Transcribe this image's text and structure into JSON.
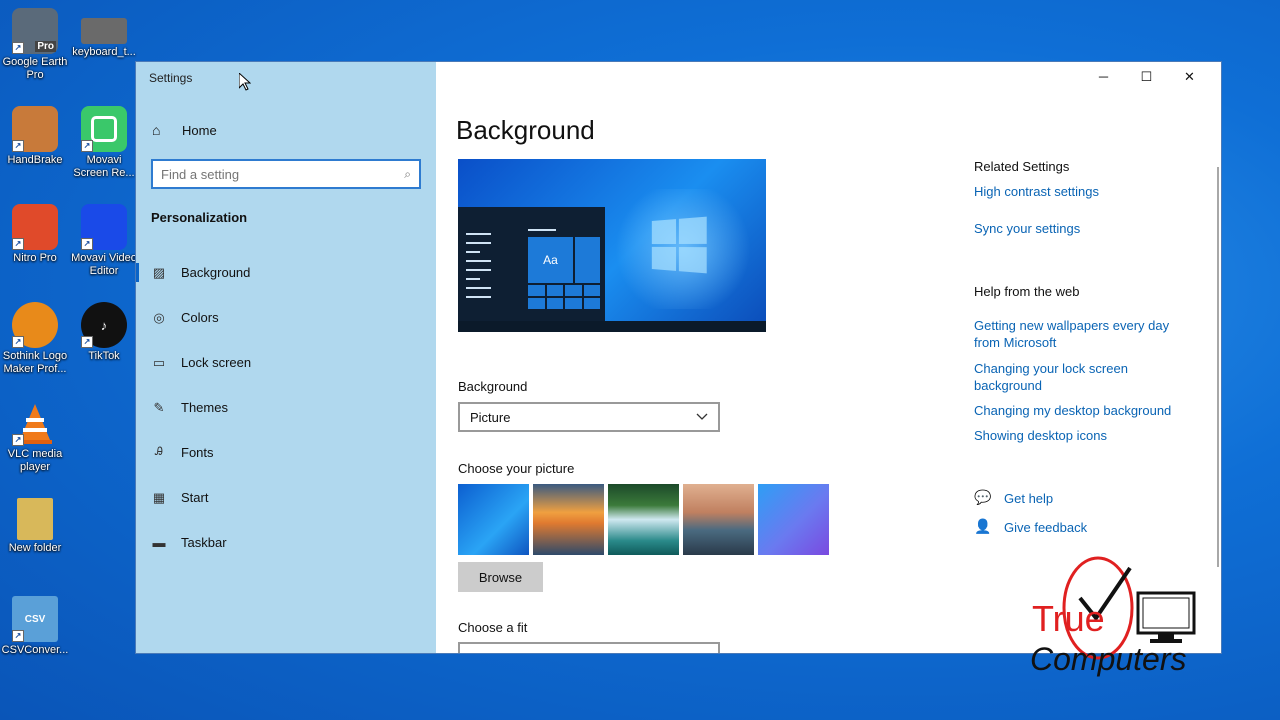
{
  "desktop": {
    "icons": [
      {
        "label": "Google Earth Pro",
        "badge": "Pro",
        "color": "#5a6a7a"
      },
      {
        "label": "keyboard_t...",
        "badge": "",
        "color": "#6a6a6a"
      },
      {
        "label": "HandBrake",
        "badge": "",
        "color": "#c87a3a"
      },
      {
        "label": "Movavi Screen Re...",
        "badge": "",
        "color": "#3ac86a"
      },
      {
        "label": "Nitro Pro",
        "badge": "",
        "color": "#e04a2a"
      },
      {
        "label": "Movavi Video Editor",
        "badge": "",
        "color": "#1a4ae8"
      },
      {
        "label": "Sothink Logo Maker Prof...",
        "badge": "",
        "color": "#e88a1a"
      },
      {
        "label": "TikTok",
        "badge": "",
        "color": "#111111"
      },
      {
        "label": "VLC media player",
        "badge": "",
        "color": "#f07a1a"
      },
      {
        "label": "New folder",
        "badge": "",
        "color": "#d8b85a"
      },
      {
        "label": "CSVConver...",
        "badge": "CSV",
        "color": "#5aa0d8"
      }
    ]
  },
  "window": {
    "title": "Settings",
    "controls": {
      "minimize": "─",
      "maximize": "☐",
      "close": "✕"
    }
  },
  "sidebar": {
    "home": "Home",
    "search_placeholder": "Find a setting",
    "section": "Personalization",
    "items": [
      {
        "label": "Background",
        "icon": "image-icon",
        "active": true
      },
      {
        "label": "Colors",
        "icon": "palette-icon",
        "active": false
      },
      {
        "label": "Lock screen",
        "icon": "lock-screen-icon",
        "active": false
      },
      {
        "label": "Themes",
        "icon": "brush-icon",
        "active": false
      },
      {
        "label": "Fonts",
        "icon": "font-icon",
        "active": false
      },
      {
        "label": "Start",
        "icon": "start-icon",
        "active": false
      },
      {
        "label": "Taskbar",
        "icon": "taskbar-icon",
        "active": false
      }
    ]
  },
  "main": {
    "title": "Background",
    "preview_tile_text": "Aa",
    "background_label": "Background",
    "background_value": "Picture",
    "choose_picture_label": "Choose your picture",
    "browse_label": "Browse",
    "choose_fit_label": "Choose a fit"
  },
  "related": {
    "heading": "Related Settings",
    "links": [
      "High contrast settings",
      "Sync your settings"
    ],
    "help_heading": "Help from the web",
    "help_links": [
      "Getting new wallpapers every day from Microsoft",
      "Changing your lock screen background",
      "Changing my desktop background",
      "Showing desktop icons"
    ],
    "get_help": "Get help",
    "give_feedback": "Give feedback"
  },
  "watermark": {
    "line1": "True",
    "line2": "Computers"
  }
}
